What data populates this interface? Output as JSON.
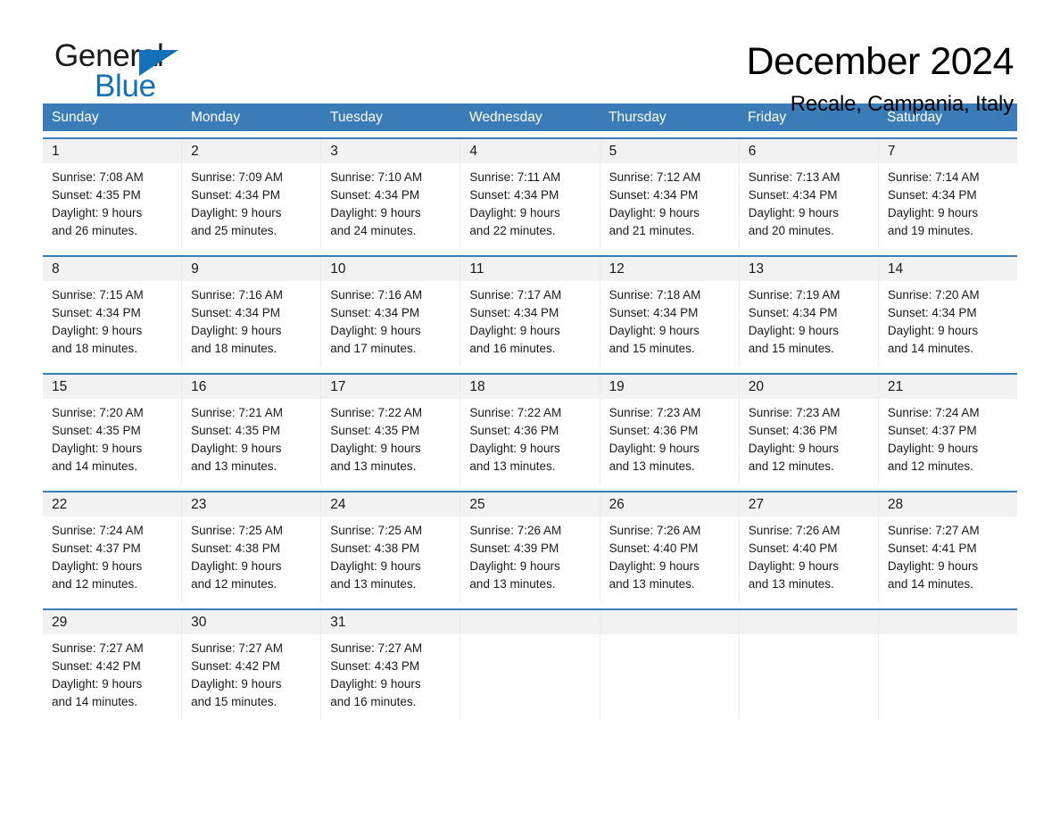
{
  "brand": {
    "name_part1": "General",
    "name_part2": "Blue",
    "accent_color": "#1271b8"
  },
  "header": {
    "month_title": "December 2024",
    "location": "Recale, Campania, Italy"
  },
  "calendar": {
    "header_color": "#3a7cb8",
    "day_band_color": "#f2f2f2",
    "weekdays": [
      "Sunday",
      "Monday",
      "Tuesday",
      "Wednesday",
      "Thursday",
      "Friday",
      "Saturday"
    ],
    "weeks": [
      [
        {
          "day": "1",
          "sunrise": "Sunrise: 7:08 AM",
          "sunset": "Sunset: 4:35 PM",
          "daylight1": "Daylight: 9 hours",
          "daylight2": "and 26 minutes."
        },
        {
          "day": "2",
          "sunrise": "Sunrise: 7:09 AM",
          "sunset": "Sunset: 4:34 PM",
          "daylight1": "Daylight: 9 hours",
          "daylight2": "and 25 minutes."
        },
        {
          "day": "3",
          "sunrise": "Sunrise: 7:10 AM",
          "sunset": "Sunset: 4:34 PM",
          "daylight1": "Daylight: 9 hours",
          "daylight2": "and 24 minutes."
        },
        {
          "day": "4",
          "sunrise": "Sunrise: 7:11 AM",
          "sunset": "Sunset: 4:34 PM",
          "daylight1": "Daylight: 9 hours",
          "daylight2": "and 22 minutes."
        },
        {
          "day": "5",
          "sunrise": "Sunrise: 7:12 AM",
          "sunset": "Sunset: 4:34 PM",
          "daylight1": "Daylight: 9 hours",
          "daylight2": "and 21 minutes."
        },
        {
          "day": "6",
          "sunrise": "Sunrise: 7:13 AM",
          "sunset": "Sunset: 4:34 PM",
          "daylight1": "Daylight: 9 hours",
          "daylight2": "and 20 minutes."
        },
        {
          "day": "7",
          "sunrise": "Sunrise: 7:14 AM",
          "sunset": "Sunset: 4:34 PM",
          "daylight1": "Daylight: 9 hours",
          "daylight2": "and 19 minutes."
        }
      ],
      [
        {
          "day": "8",
          "sunrise": "Sunrise: 7:15 AM",
          "sunset": "Sunset: 4:34 PM",
          "daylight1": "Daylight: 9 hours",
          "daylight2": "and 18 minutes."
        },
        {
          "day": "9",
          "sunrise": "Sunrise: 7:16 AM",
          "sunset": "Sunset: 4:34 PM",
          "daylight1": "Daylight: 9 hours",
          "daylight2": "and 18 minutes."
        },
        {
          "day": "10",
          "sunrise": "Sunrise: 7:16 AM",
          "sunset": "Sunset: 4:34 PM",
          "daylight1": "Daylight: 9 hours",
          "daylight2": "and 17 minutes."
        },
        {
          "day": "11",
          "sunrise": "Sunrise: 7:17 AM",
          "sunset": "Sunset: 4:34 PM",
          "daylight1": "Daylight: 9 hours",
          "daylight2": "and 16 minutes."
        },
        {
          "day": "12",
          "sunrise": "Sunrise: 7:18 AM",
          "sunset": "Sunset: 4:34 PM",
          "daylight1": "Daylight: 9 hours",
          "daylight2": "and 15 minutes."
        },
        {
          "day": "13",
          "sunrise": "Sunrise: 7:19 AM",
          "sunset": "Sunset: 4:34 PM",
          "daylight1": "Daylight: 9 hours",
          "daylight2": "and 15 minutes."
        },
        {
          "day": "14",
          "sunrise": "Sunrise: 7:20 AM",
          "sunset": "Sunset: 4:34 PM",
          "daylight1": "Daylight: 9 hours",
          "daylight2": "and 14 minutes."
        }
      ],
      [
        {
          "day": "15",
          "sunrise": "Sunrise: 7:20 AM",
          "sunset": "Sunset: 4:35 PM",
          "daylight1": "Daylight: 9 hours",
          "daylight2": "and 14 minutes."
        },
        {
          "day": "16",
          "sunrise": "Sunrise: 7:21 AM",
          "sunset": "Sunset: 4:35 PM",
          "daylight1": "Daylight: 9 hours",
          "daylight2": "and 13 minutes."
        },
        {
          "day": "17",
          "sunrise": "Sunrise: 7:22 AM",
          "sunset": "Sunset: 4:35 PM",
          "daylight1": "Daylight: 9 hours",
          "daylight2": "and 13 minutes."
        },
        {
          "day": "18",
          "sunrise": "Sunrise: 7:22 AM",
          "sunset": "Sunset: 4:36 PM",
          "daylight1": "Daylight: 9 hours",
          "daylight2": "and 13 minutes."
        },
        {
          "day": "19",
          "sunrise": "Sunrise: 7:23 AM",
          "sunset": "Sunset: 4:36 PM",
          "daylight1": "Daylight: 9 hours",
          "daylight2": "and 13 minutes."
        },
        {
          "day": "20",
          "sunrise": "Sunrise: 7:23 AM",
          "sunset": "Sunset: 4:36 PM",
          "daylight1": "Daylight: 9 hours",
          "daylight2": "and 12 minutes."
        },
        {
          "day": "21",
          "sunrise": "Sunrise: 7:24 AM",
          "sunset": "Sunset: 4:37 PM",
          "daylight1": "Daylight: 9 hours",
          "daylight2": "and 12 minutes."
        }
      ],
      [
        {
          "day": "22",
          "sunrise": "Sunrise: 7:24 AM",
          "sunset": "Sunset: 4:37 PM",
          "daylight1": "Daylight: 9 hours",
          "daylight2": "and 12 minutes."
        },
        {
          "day": "23",
          "sunrise": "Sunrise: 7:25 AM",
          "sunset": "Sunset: 4:38 PM",
          "daylight1": "Daylight: 9 hours",
          "daylight2": "and 12 minutes."
        },
        {
          "day": "24",
          "sunrise": "Sunrise: 7:25 AM",
          "sunset": "Sunset: 4:38 PM",
          "daylight1": "Daylight: 9 hours",
          "daylight2": "and 13 minutes."
        },
        {
          "day": "25",
          "sunrise": "Sunrise: 7:26 AM",
          "sunset": "Sunset: 4:39 PM",
          "daylight1": "Daylight: 9 hours",
          "daylight2": "and 13 minutes."
        },
        {
          "day": "26",
          "sunrise": "Sunrise: 7:26 AM",
          "sunset": "Sunset: 4:40 PM",
          "daylight1": "Daylight: 9 hours",
          "daylight2": "and 13 minutes."
        },
        {
          "day": "27",
          "sunrise": "Sunrise: 7:26 AM",
          "sunset": "Sunset: 4:40 PM",
          "daylight1": "Daylight: 9 hours",
          "daylight2": "and 13 minutes."
        },
        {
          "day": "28",
          "sunrise": "Sunrise: 7:27 AM",
          "sunset": "Sunset: 4:41 PM",
          "daylight1": "Daylight: 9 hours",
          "daylight2": "and 14 minutes."
        }
      ],
      [
        {
          "day": "29",
          "sunrise": "Sunrise: 7:27 AM",
          "sunset": "Sunset: 4:42 PM",
          "daylight1": "Daylight: 9 hours",
          "daylight2": "and 14 minutes."
        },
        {
          "day": "30",
          "sunrise": "Sunrise: 7:27 AM",
          "sunset": "Sunset: 4:42 PM",
          "daylight1": "Daylight: 9 hours",
          "daylight2": "and 15 minutes."
        },
        {
          "day": "31",
          "sunrise": "Sunrise: 7:27 AM",
          "sunset": "Sunset: 4:43 PM",
          "daylight1": "Daylight: 9 hours",
          "daylight2": "and 16 minutes."
        },
        {
          "day": "",
          "sunrise": "",
          "sunset": "",
          "daylight1": "",
          "daylight2": ""
        },
        {
          "day": "",
          "sunrise": "",
          "sunset": "",
          "daylight1": "",
          "daylight2": ""
        },
        {
          "day": "",
          "sunrise": "",
          "sunset": "",
          "daylight1": "",
          "daylight2": ""
        },
        {
          "day": "",
          "sunrise": "",
          "sunset": "",
          "daylight1": "",
          "daylight2": ""
        }
      ]
    ]
  }
}
